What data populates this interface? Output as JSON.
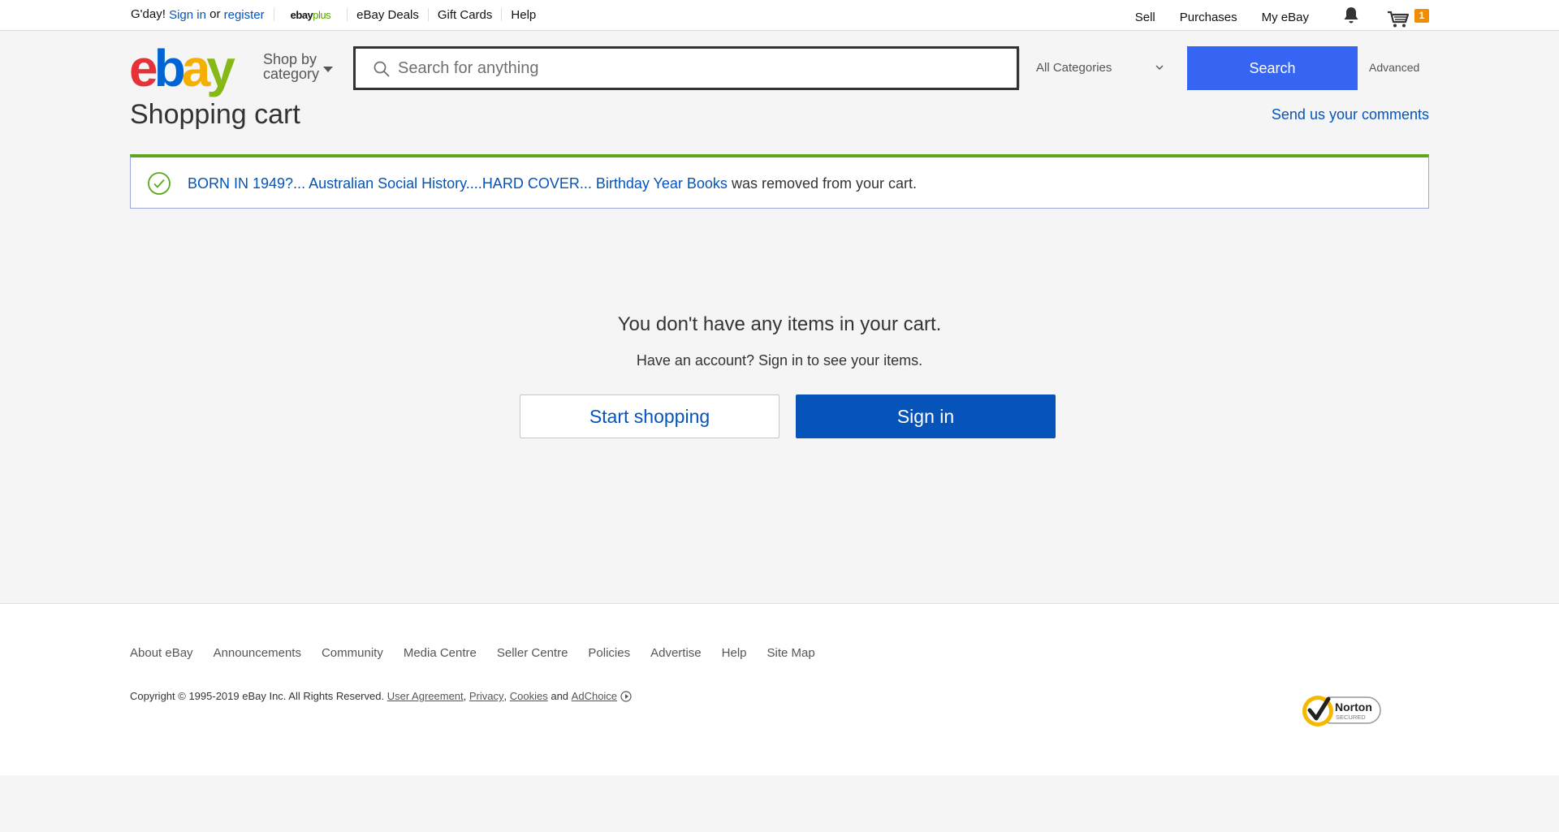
{
  "topbar": {
    "greeting": "G'day!",
    "signin": "Sign in",
    "or": "or",
    "register": "register",
    "ebayplus_a": "ebay",
    "ebayplus_b": "plus",
    "deals": "eBay Deals",
    "giftcards": "Gift Cards",
    "help": "Help",
    "sell": "Sell",
    "purchases": "Purchases",
    "myebay": "My eBay",
    "cart_count": "1"
  },
  "header": {
    "logo": [
      "e",
      "b",
      "a",
      "y"
    ],
    "shop_by": "Shop by",
    "category": "category",
    "search_placeholder": "Search for anything",
    "category_select": "All Categories",
    "search_button": "Search",
    "advanced": "Advanced"
  },
  "page": {
    "title": "Shopping cart",
    "comments_link": "Send us your comments"
  },
  "notice": {
    "item_link": "BORN IN 1949?... Australian Social History....HARD COVER... Birthday Year Books",
    "message": " was removed from your cart."
  },
  "empty_cart": {
    "title": "You don't have any items in your cart.",
    "subtitle": "Have an account? Sign in to see your items.",
    "start_shopping": "Start shopping",
    "sign_in": "Sign in"
  },
  "footer": {
    "links": [
      "About eBay",
      "Announcements",
      "Community",
      "Media Centre",
      "Seller Centre",
      "Policies",
      "Advertise",
      "Help",
      "Site Map"
    ],
    "copyright": "Copyright © 1995-2019 eBay Inc. All Rights Reserved.",
    "user_agreement": "User Agreement",
    "privacy": "Privacy",
    "cookies": "Cookies",
    "and": "and",
    "adchoice": "AdChoice",
    "norton_title": "Norton",
    "norton_sub": "SECURED"
  },
  "colors": {
    "search_blue": "#3665f3",
    "link_blue": "#0654ba",
    "success_green": "#5ba71b",
    "badge_orange": "#f18e00"
  }
}
